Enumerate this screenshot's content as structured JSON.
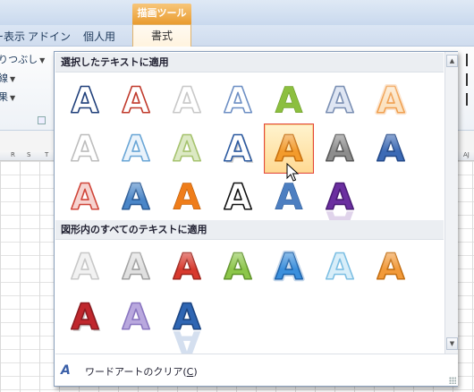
{
  "ribbon": {
    "context_group": "描画ツール",
    "tabs": [
      {
        "label": "ー表示"
      },
      {
        "label": "アドイン"
      },
      {
        "label": "個人用"
      }
    ],
    "active_tab": "書式",
    "left_items": [
      {
        "label": "りつぶし",
        "icon": "paint-bucket-icon"
      },
      {
        "label": "線",
        "icon": "line-icon"
      },
      {
        "label": "果",
        "icon": "effects-icon"
      }
    ]
  },
  "sheet": {
    "column_headers": [
      "R",
      "S",
      "T",
      "AJ"
    ]
  },
  "gallery": {
    "section1_title": "選択したテキストに適用",
    "section2_title": "図形内のすべてのテキストに適用",
    "glyph": "A",
    "section1_styles": [
      {
        "name": "wordart-style-1",
        "fill": "#ffffff",
        "stroke": "#1f3f7a",
        "effect": "outline"
      },
      {
        "name": "wordart-style-2",
        "fill": "#ffffff",
        "stroke": "#c0392b",
        "effect": "outline"
      },
      {
        "name": "wordart-style-3",
        "fill": "#ffffff",
        "stroke": "#c8c8c8",
        "effect": "outline"
      },
      {
        "name": "wordart-style-4",
        "fill": "#ffffff",
        "stroke": "#6d8fc4",
        "effect": "outline"
      },
      {
        "name": "wordart-style-5",
        "fill": "#8cbf3f",
        "stroke": "#6b9a2a",
        "effect": "flat"
      },
      {
        "name": "wordart-style-6",
        "fill": "#dfe6f3",
        "stroke": "#7a8fb3",
        "effect": "outline"
      },
      {
        "name": "wordart-style-7",
        "fill": "#fbe3c2",
        "stroke": "#f0a050",
        "effect": "glow"
      },
      {
        "name": "wordart-style-8",
        "fill": "#ffffff",
        "stroke": "#bdbdbd",
        "effect": "outline"
      },
      {
        "name": "wordart-style-9",
        "fill": "#eaf3fb",
        "stroke": "#6aa6d6",
        "effect": "outline"
      },
      {
        "name": "wordart-style-10",
        "fill": "#dce9c4",
        "stroke": "#a6c36f",
        "effect": "outline"
      },
      {
        "name": "wordart-style-11",
        "fill": "#ffffff",
        "stroke": "#2c5aa0",
        "effect": "shadow"
      },
      {
        "name": "wordart-style-12",
        "fill": "#f39b2c",
        "stroke": "#c8700f",
        "effect": "bevel"
      },
      {
        "name": "wordart-style-13",
        "fill": "#8d8d8d",
        "stroke": "#595959",
        "effect": "bevel"
      },
      {
        "name": "wordart-style-14",
        "fill": "#3c6ab5",
        "stroke": "#244a8a",
        "effect": "bevel"
      },
      {
        "name": "wordart-style-15",
        "fill": "#f6d3d0",
        "stroke": "#d0463a",
        "effect": "outline"
      },
      {
        "name": "wordart-style-16",
        "fill": "#4a86c8",
        "stroke": "#2a5b96",
        "effect": "gradient"
      },
      {
        "name": "wordart-style-17",
        "fill": "#ef7d1a",
        "stroke": "#b85a07",
        "effect": "flat"
      },
      {
        "name": "wordart-style-18",
        "fill": "#ffffff",
        "stroke": "#111111",
        "effect": "outline"
      },
      {
        "name": "wordart-style-19",
        "fill": "#4d7fc1",
        "stroke": "#2f5d99",
        "effect": "flat"
      },
      {
        "name": "wordart-style-20",
        "fill": "#6b2fa0",
        "stroke": "#4b1d77",
        "effect": "reflection"
      }
    ],
    "section2_styles": [
      {
        "name": "wordart-shape-style-1",
        "fill": "#f2f2f2",
        "stroke": "#c8c8c8",
        "effect": "outline"
      },
      {
        "name": "wordart-shape-style-2",
        "fill": "#e0e0e0",
        "stroke": "#a0a0a0",
        "effect": "bevel"
      },
      {
        "name": "wordart-shape-style-3",
        "fill": "#d8392e",
        "stroke": "#a0271f",
        "effect": "bevel"
      },
      {
        "name": "wordart-shape-style-4",
        "fill": "#8cc64a",
        "stroke": "#62952c",
        "effect": "bevel"
      },
      {
        "name": "wordart-shape-style-5",
        "fill": "#3b8fdc",
        "stroke": "#1f65ad",
        "effect": "glow"
      },
      {
        "name": "wordart-shape-style-6",
        "fill": "#d8eef9",
        "stroke": "#7dbfe3",
        "effect": "outline"
      },
      {
        "name": "wordart-shape-style-7",
        "fill": "#f29a3a",
        "stroke": "#c46f13",
        "effect": "bevel"
      },
      {
        "name": "wordart-shape-style-8",
        "fill": "#c0272d",
        "stroke": "#8d1b20",
        "effect": "shadow"
      },
      {
        "name": "wordart-shape-style-9",
        "fill": "#b9a8de",
        "stroke": "#8a76c0",
        "effect": "outline"
      },
      {
        "name": "wordart-shape-style-10",
        "fill": "#2f66b3",
        "stroke": "#1d4683",
        "effect": "reflection"
      }
    ],
    "clear_label_prefix": "ワードアートのクリア(",
    "clear_label_key": "C",
    "clear_label_suffix": ")",
    "selected_index": 11
  }
}
